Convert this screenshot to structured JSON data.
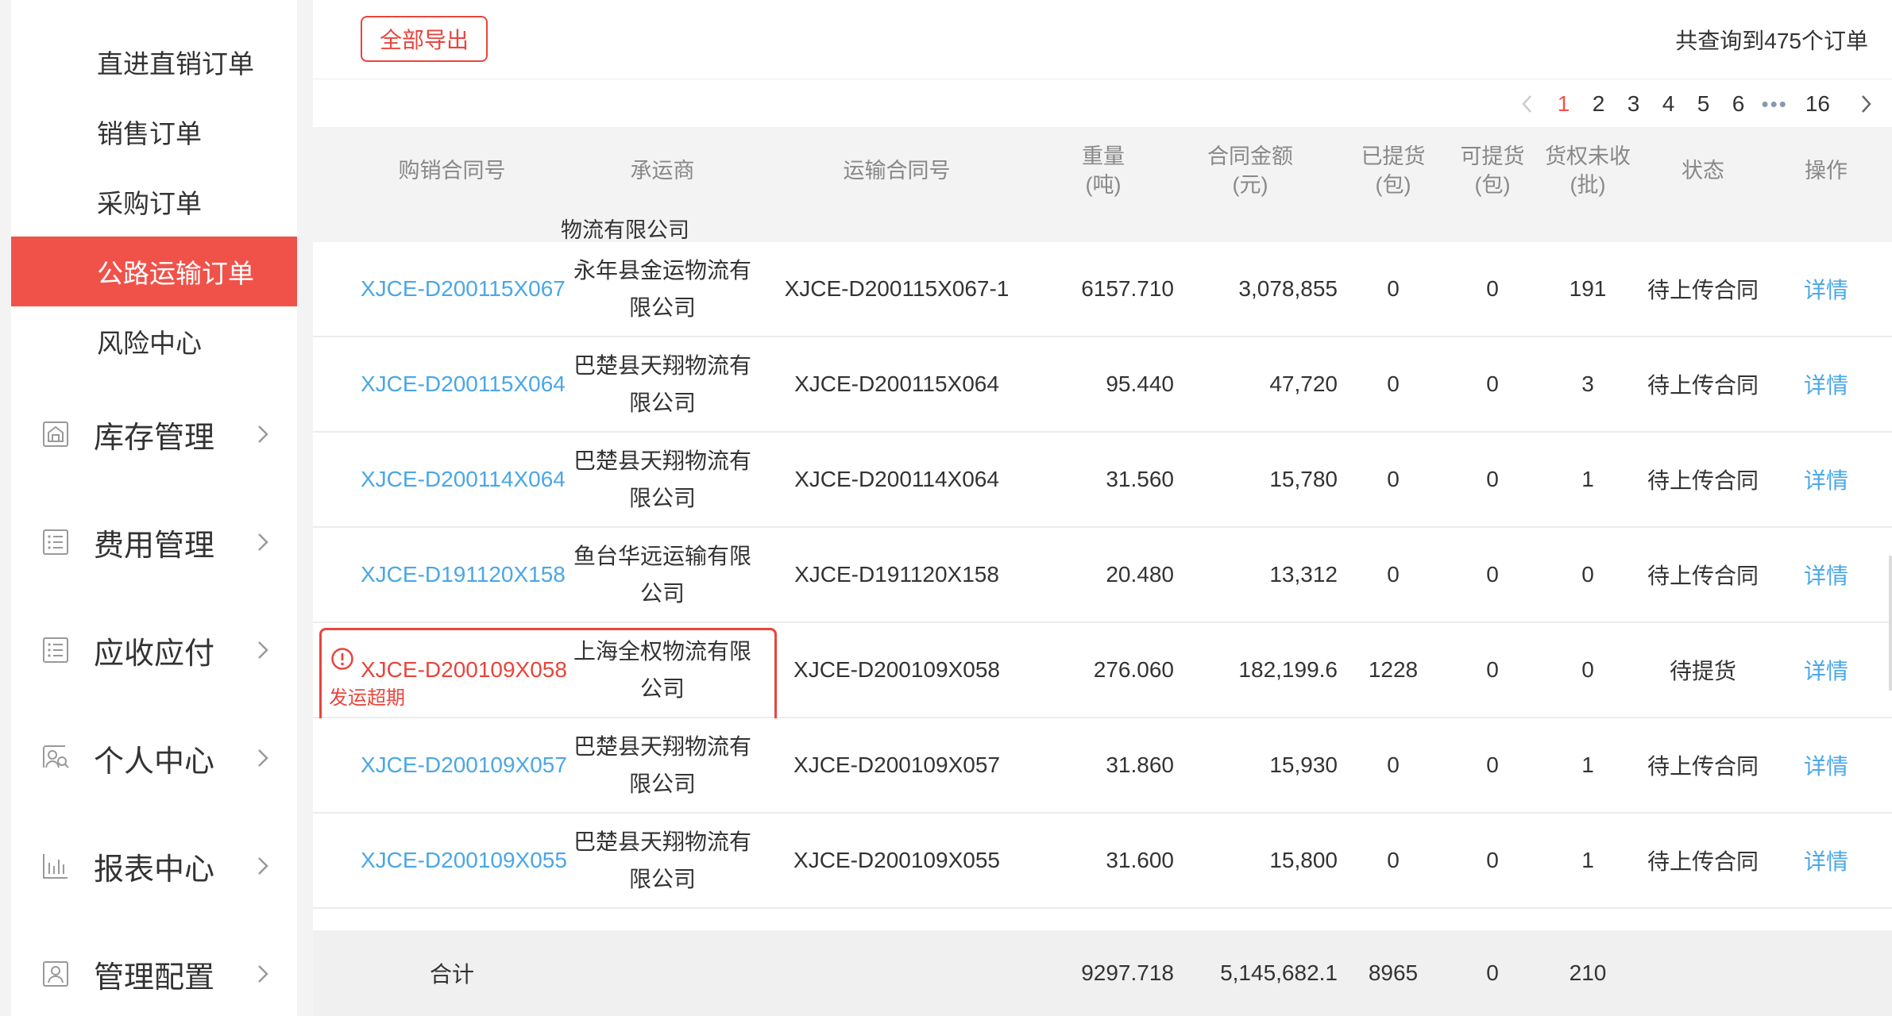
{
  "sidebar": {
    "sub_items": [
      "直进直销订单",
      "销售订单",
      "采购订单",
      "公路运输订单",
      "风险中心"
    ],
    "active_sub_index": 3,
    "groups": [
      {
        "label": "库存管理",
        "icon": "warehouse-icon"
      },
      {
        "label": "费用管理",
        "icon": "list-icon"
      },
      {
        "label": "应收应付",
        "icon": "list-icon"
      },
      {
        "label": "个人中心",
        "icon": "person-search-icon"
      },
      {
        "label": "报表中心",
        "icon": "bar-chart-icon"
      },
      {
        "label": "管理配置",
        "icon": "user-card-icon"
      }
    ]
  },
  "toolbar": {
    "export_label": "全部导出",
    "total_text": "共查询到475个订单"
  },
  "pagination": {
    "pages": [
      "1",
      "2",
      "3",
      "4",
      "5",
      "6"
    ],
    "current": "1",
    "ellipsis": "•••",
    "last": "16"
  },
  "table": {
    "headers": {
      "contract_no": "购销合同号",
      "carrier": "承运商",
      "transport_no": "运输合同号",
      "weight": [
        "重量",
        "(吨)"
      ],
      "amount": [
        "合同金额",
        "(元)"
      ],
      "picked": [
        "已提货",
        "(包)"
      ],
      "pickable": [
        "可提货",
        "(包)"
      ],
      "unpaid": [
        "货权未收",
        "(批)"
      ],
      "status": "状态",
      "action": "操作"
    },
    "cut_off_text": "物流有限公司",
    "rows": [
      {
        "contract_no": "XJCE-D200115X067",
        "carrier": [
          "永年县金运物流有",
          "限公司"
        ],
        "transport_no": "XJCE-D200115X067-1",
        "weight": "6157.710",
        "amount": "3,078,855",
        "picked": "0",
        "pickable": "0",
        "unpaid": "191",
        "status": "待上传合同",
        "action": "详情",
        "warning": ""
      },
      {
        "contract_no": "XJCE-D200115X064",
        "carrier": [
          "巴楚县天翔物流有",
          "限公司"
        ],
        "transport_no": "XJCE-D200115X064",
        "weight": "95.440",
        "amount": "47,720",
        "picked": "0",
        "pickable": "0",
        "unpaid": "3",
        "status": "待上传合同",
        "action": "详情",
        "warning": ""
      },
      {
        "contract_no": "XJCE-D200114X064",
        "carrier": [
          "巴楚县天翔物流有",
          "限公司"
        ],
        "transport_no": "XJCE-D200114X064",
        "weight": "31.560",
        "amount": "15,780",
        "picked": "0",
        "pickable": "0",
        "unpaid": "1",
        "status": "待上传合同",
        "action": "详情",
        "warning": ""
      },
      {
        "contract_no": "XJCE-D191120X158",
        "carrier": [
          "鱼台华远运输有限",
          "公司"
        ],
        "transport_no": "XJCE-D191120X158",
        "weight": "20.480",
        "amount": "13,312",
        "picked": "0",
        "pickable": "0",
        "unpaid": "0",
        "status": "待上传合同",
        "action": "详情",
        "warning": ""
      },
      {
        "contract_no": "XJCE-D200109X058",
        "carrier": [
          "上海全权物流有限",
          "公司"
        ],
        "transport_no": "XJCE-D200109X058",
        "weight": "276.060",
        "amount": "182,199.6",
        "picked": "1228",
        "pickable": "0",
        "unpaid": "0",
        "status": "待提货",
        "action": "详情",
        "warning": "发运超期"
      },
      {
        "contract_no": "XJCE-D200109X057",
        "carrier": [
          "巴楚县天翔物流有",
          "限公司"
        ],
        "transport_no": "XJCE-D200109X057",
        "weight": "31.860",
        "amount": "15,930",
        "picked": "0",
        "pickable": "0",
        "unpaid": "1",
        "status": "待上传合同",
        "action": "详情",
        "warning": ""
      },
      {
        "contract_no": "XJCE-D200109X055",
        "carrier": [
          "巴楚县天翔物流有",
          "限公司"
        ],
        "transport_no": "XJCE-D200109X055",
        "weight": "31.600",
        "amount": "15,800",
        "picked": "0",
        "pickable": "0",
        "unpaid": "1",
        "status": "待上传合同",
        "action": "详情",
        "warning": ""
      }
    ],
    "summary": {
      "label": "合计",
      "weight": "9297.718",
      "amount": "5,145,682.1",
      "picked": "8965",
      "pickable": "0",
      "unpaid": "210"
    }
  },
  "colors": {
    "accent_red": "#f0524a",
    "warning_red": "#e8453c",
    "link_blue": "#4aa7e6",
    "header_gray": "#888888"
  }
}
